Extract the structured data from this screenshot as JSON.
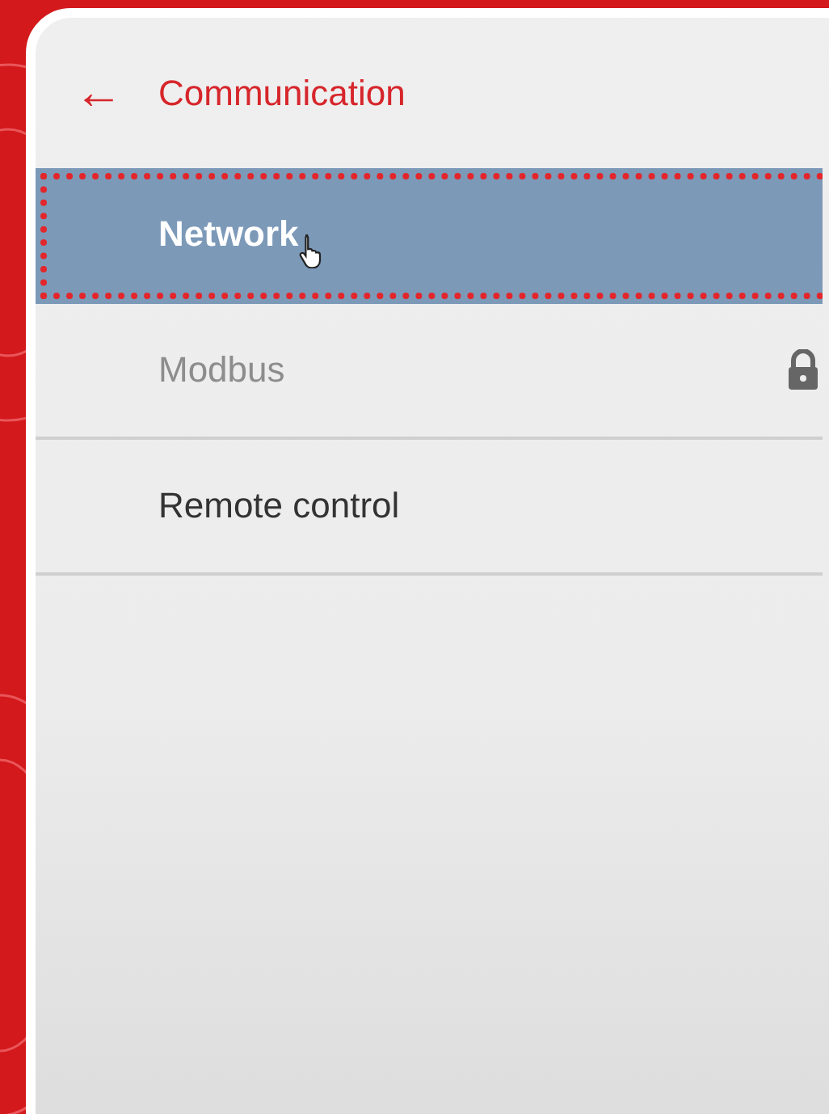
{
  "header": {
    "back": "←",
    "title": "Communication"
  },
  "items": [
    {
      "label": "Network",
      "selected": true,
      "disabled": false,
      "locked": false
    },
    {
      "label": "Modbus",
      "selected": false,
      "disabled": true,
      "locked": true
    },
    {
      "label": "Remote control",
      "selected": false,
      "disabled": false,
      "locked": false
    }
  ]
}
